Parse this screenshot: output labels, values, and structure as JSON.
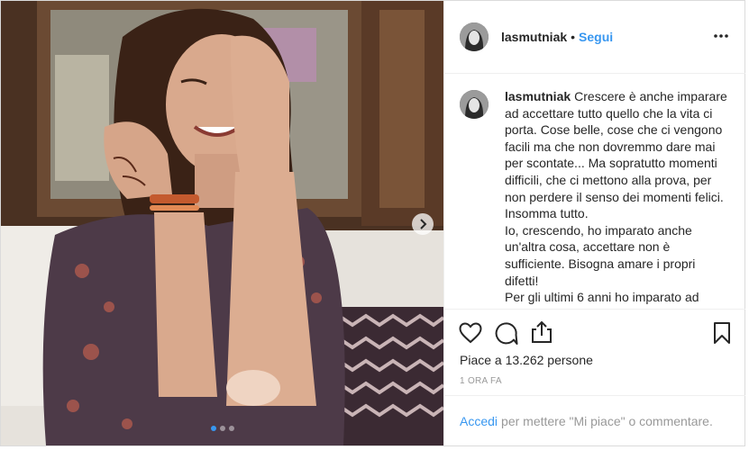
{
  "post": {
    "username": "lasmutniak",
    "separator": "•",
    "follow_label": "Segui",
    "caption": "Crescere è anche imparare ad accettare tutto quello che la vita ci porta. Cose belle, cose che ci vengono facili ma che non dovremmo dare mai per scontate... Ma sopratutto momenti difficili, che ci mettono alla prova, per non perdere il senso dei momenti felici. Insomma tutto.\nIo, crescendo, ho imparato anche un'altra cosa, accettare non è sufficiente. Bisogna amare i propri difetti!\nPer gli ultimi 6 anni ho imparato ad",
    "likes_text": "Piace a 13.262 persone",
    "timestamp": "1 ORA FA",
    "login_link": "Accedi",
    "login_text": "per mettere \"Mi piace\" o commentare."
  },
  "carousel": {
    "total": 3,
    "active_index": 0
  },
  "icons": {
    "more": "more-options-icon",
    "like": "heart-icon",
    "comment": "comment-icon",
    "share": "share-icon",
    "save": "bookmark-icon",
    "next": "chevron-right-icon"
  },
  "colors": {
    "link": "#3897f0",
    "text": "#262626",
    "muted": "#999999",
    "border": "#efefef"
  }
}
